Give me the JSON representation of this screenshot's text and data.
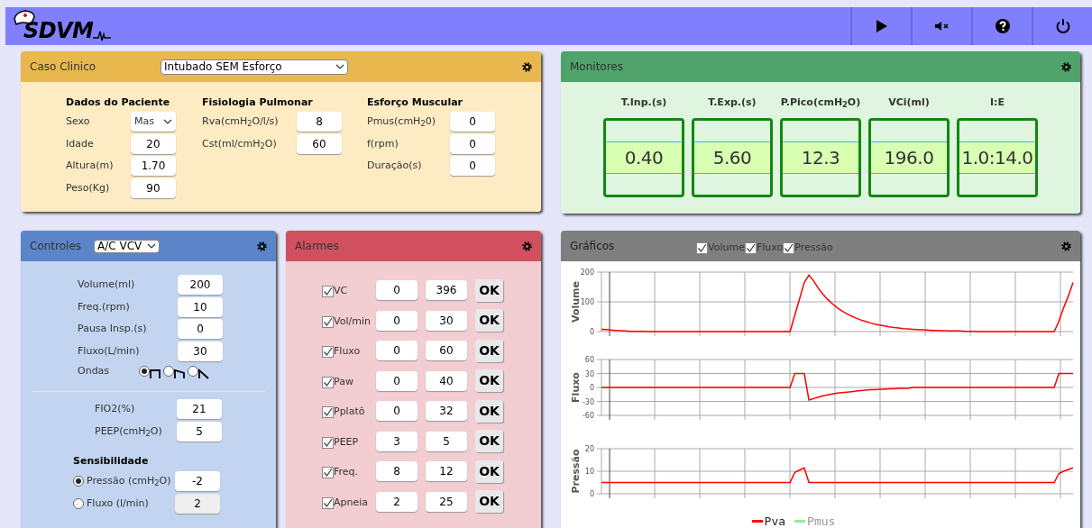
{
  "header": {
    "logo": "SDVM",
    "buttons": [
      {
        "kind": "play"
      },
      {
        "kind": "mute"
      },
      {
        "kind": "help"
      },
      {
        "kind": "power"
      }
    ]
  },
  "caso_clinico": {
    "title": "Caso Clinico",
    "case": "Intubado SEM Esforço",
    "sections": [
      {
        "heading": "Dados do Paciente",
        "fields": [
          {
            "label": "Sexo",
            "value": "Mas",
            "kind": "select"
          },
          {
            "label": "Idade",
            "value": "20",
            "kind": "input"
          },
          {
            "label": "Altura(m)",
            "value": "1.70",
            "kind": "input"
          },
          {
            "label": "Peso(Kg)",
            "value": "90",
            "kind": "input"
          }
        ]
      },
      {
        "heading": "Fisiologia Pulmonar",
        "fields": [
          {
            "label": "Rva(cmH$_{2}$O/l/s)",
            "value": "8",
            "kind": "input"
          },
          {
            "label": "Cst(ml/cmH$_{2}$O)",
            "value": "60",
            "kind": "input"
          }
        ]
      },
      {
        "heading": "Esforço Muscular",
        "fields": [
          {
            "label": "Pmus(cmH$_{2}$0)",
            "value": "0",
            "kind": "input"
          },
          {
            "label": "f(rpm)",
            "value": "0",
            "kind": "input"
          },
          {
            "label": "Duração(s)",
            "value": "0",
            "kind": "input"
          }
        ]
      }
    ]
  },
  "monitores": {
    "title": "Monitores",
    "items": [
      {
        "label": "T.Inp.(s)",
        "value": "0.40"
      },
      {
        "label": "T.Exp.(s)",
        "value": "5.60"
      },
      {
        "label": "P.Pico(cmH$_{2}$O)",
        "value": "12.3"
      },
      {
        "label": "VCi(ml)",
        "value": "196.0"
      },
      {
        "label": "I:E",
        "value": "1.0:14.0"
      }
    ]
  },
  "controles": {
    "title": "Controles",
    "mode": "A/C VCV",
    "fields": [
      {
        "label": "Volume(ml)",
        "value": "200"
      },
      {
        "label": "Freq.(rpm)",
        "value": "10"
      },
      {
        "label": "Pausa Insp.(s)",
        "value": "0"
      },
      {
        "label": "Fluxo(L/min)",
        "value": "30"
      }
    ],
    "waves": {
      "label": "Ondas",
      "options": [
        {
          "kind": "square",
          "selected": true
        },
        {
          "kind": "descending",
          "selected": false
        },
        {
          "kind": "ramp",
          "selected": false
        }
      ]
    },
    "fields2": [
      {
        "label": "FIO2(%)",
        "value": "21"
      },
      {
        "label": "PEEP(cmH$_{2}$O)",
        "value": "5"
      }
    ],
    "sensibilidade": {
      "heading": "Sensibilidade",
      "options": [
        {
          "label": "Pressão (cmH$_{2}$O)",
          "value": "-2",
          "selected": true
        },
        {
          "label": "Fluxo (l/min)",
          "value": "2",
          "selected": false
        }
      ]
    }
  },
  "alarmes": {
    "title": "Alarmes",
    "rows": [
      {
        "label": "VC",
        "checked": true,
        "min": "0",
        "max": "396",
        "button": "OK"
      },
      {
        "label": "Vol/min",
        "checked": true,
        "min": "0",
        "max": "30",
        "button": "OK"
      },
      {
        "label": "Fluxo",
        "checked": true,
        "min": "0",
        "max": "60",
        "button": "OK"
      },
      {
        "label": "Paw",
        "checked": true,
        "min": "0",
        "max": "40",
        "button": "OK"
      },
      {
        "label": "Pplatô",
        "checked": true,
        "min": "0",
        "max": "32",
        "button": "OK"
      },
      {
        "label": "PEEP",
        "checked": true,
        "min": "3",
        "max": "5",
        "button": "OK"
      },
      {
        "label": "Freq.",
        "checked": true,
        "min": "8",
        "max": "12",
        "button": "OK"
      },
      {
        "label": "Apneia",
        "checked": true,
        "min": "2",
        "max": "25",
        "button": "OK"
      }
    ]
  },
  "graficos": {
    "title": "Gráficos",
    "toggles": [
      {
        "label": "Volume",
        "checked": true
      },
      {
        "label": "Fluxo",
        "checked": true
      },
      {
        "label": "Pressão",
        "checked": true
      }
    ],
    "charts": [
      {
        "chart_data": {
          "type": "line",
          "grid": true,
          "ylabel": "Volume",
          "ylim": [
            0,
            200
          ],
          "yticks": [
            0,
            100,
            200
          ],
          "categories": [
            null,
            null,
            null,
            null,
            null,
            null,
            null,
            null,
            null,
            null,
            null,
            null,
            null,
            null,
            null,
            null,
            null,
            null,
            null,
            null,
            null,
            null,
            null,
            null,
            null,
            null,
            null,
            null,
            null,
            null,
            null,
            null,
            null,
            null,
            null,
            null,
            null,
            null,
            null,
            null,
            null,
            null,
            null,
            null,
            null,
            null,
            null,
            null,
            null,
            null,
            null,
            null,
            null,
            null,
            null,
            null,
            null,
            null,
            null,
            null,
            null,
            null,
            null,
            null,
            null,
            null,
            null,
            null,
            null,
            null,
            null,
            null,
            null,
            null,
            null,
            null,
            null,
            null,
            null,
            null,
            null,
            null,
            null,
            null,
            null,
            null,
            null,
            null,
            null,
            null,
            null,
            null,
            null,
            null,
            null,
            null,
            null,
            null,
            null,
            null,
            null
          ],
          "series": [
            {
              "color": "#ff0000",
              "values": [
                8,
                7,
                5,
                4,
                3,
                2,
                1,
                1,
                1,
                1,
                0,
                0,
                0,
                0,
                0,
                0,
                0,
                0,
                0,
                0,
                0,
                0,
                0,
                0,
                0,
                0,
                0,
                0,
                0,
                0,
                0,
                0,
                0,
                0,
                0,
                0,
                0,
                0,
                0,
                0,
                0,
                55,
                110,
                165,
                190,
                170,
                145,
                125,
                108,
                93,
                80,
                69,
                60,
                52,
                45,
                39,
                34,
                29,
                25,
                22,
                19,
                16,
                14,
                12,
                10,
                9,
                8,
                7,
                6,
                5,
                4,
                4,
                3,
                3,
                2,
                2,
                2,
                1,
                1,
                1,
                0,
                0,
                0,
                0,
                0,
                0,
                0,
                0,
                0,
                0,
                0,
                0,
                0,
                0,
                0,
                0,
                0,
                35,
                80,
                120,
                165
              ]
            }
          ]
        }
      },
      {
        "chart_data": {
          "type": "line",
          "grid": true,
          "ylabel": "Fluxo",
          "ylim": [
            -60,
            60
          ],
          "yticks": [
            -60,
            -30,
            0,
            30,
            60
          ],
          "categories": [
            null,
            null,
            null,
            null,
            null,
            null,
            null,
            null,
            null,
            null,
            null,
            null,
            null,
            null,
            null,
            null,
            null,
            null,
            null,
            null,
            null,
            null,
            null,
            null,
            null,
            null,
            null,
            null,
            null,
            null,
            null,
            null,
            null,
            null,
            null,
            null,
            null,
            null,
            null,
            null,
            null,
            null,
            null,
            null,
            null,
            null,
            null,
            null,
            null,
            null,
            null,
            null,
            null,
            null,
            null,
            null,
            null,
            null,
            null,
            null,
            null,
            null,
            null,
            null,
            null,
            null,
            null,
            null,
            null,
            null,
            null,
            null,
            null,
            null,
            null,
            null,
            null,
            null,
            null,
            null,
            null,
            null,
            null,
            null,
            null,
            null,
            null,
            null,
            null,
            null,
            null,
            null,
            null,
            null,
            null,
            null,
            null,
            null,
            null,
            null,
            null
          ],
          "series": [
            {
              "color": "#ff0000",
              "values": [
                0,
                0,
                0,
                0,
                0,
                0,
                0,
                0,
                0,
                0,
                0,
                0,
                0,
                0,
                0,
                0,
                0,
                0,
                0,
                0,
                0,
                0,
                0,
                0,
                0,
                0,
                0,
                0,
                0,
                0,
                0,
                0,
                0,
                0,
                0,
                0,
                0,
                0,
                0,
                0,
                0,
                30,
                30,
                30,
                -27,
                -24,
                -21,
                -18,
                -16,
                -14,
                -12,
                -11,
                -10,
                -9,
                -8,
                -7,
                -6,
                -5,
                -5,
                -4,
                -4,
                -3,
                -3,
                -2,
                -2,
                -2,
                0,
                0,
                0,
                0,
                0,
                0,
                0,
                0,
                0,
                0,
                0,
                0,
                0,
                0,
                0,
                0,
                0,
                0,
                0,
                0,
                0,
                0,
                0,
                0,
                0,
                0,
                0,
                0,
                0,
                0,
                0,
                30,
                30,
                30,
                30
              ]
            }
          ]
        }
      },
      {
        "chart_data": {
          "type": "line",
          "grid": true,
          "ylabel": "Pressão",
          "ylim": [
            0,
            20
          ],
          "yticks": [
            0,
            10,
            20
          ],
          "categories": [
            null,
            null,
            null,
            null,
            null,
            null,
            null,
            null,
            null,
            null,
            null,
            null,
            null,
            null,
            null,
            null,
            null,
            null,
            null,
            null,
            null,
            null,
            null,
            null,
            null,
            null,
            null,
            null,
            null,
            null,
            null,
            null,
            null,
            null,
            null,
            null,
            null,
            null,
            null,
            null,
            null,
            null,
            null,
            null,
            null,
            null,
            null,
            null,
            null,
            null,
            null,
            null,
            null,
            null,
            null,
            null,
            null,
            null,
            null,
            null,
            null,
            null,
            null,
            null,
            null,
            null,
            null,
            null,
            null,
            null,
            null,
            null,
            null,
            null,
            null,
            null,
            null,
            null,
            null,
            null,
            null,
            null,
            null,
            null,
            null,
            null,
            null,
            null,
            null,
            null,
            null,
            null,
            null,
            null,
            null,
            null,
            null,
            null,
            null,
            null,
            null
          ],
          "series": [
            {
              "name": "Pva",
              "color": "#ff0000",
              "values": [
                5,
                5,
                5,
                5,
                5,
                5,
                5,
                5,
                5,
                5,
                5,
                5,
                5,
                5,
                5,
                5,
                5,
                5,
                5,
                5,
                5,
                5,
                5,
                5,
                5,
                5,
                5,
                5,
                5,
                5,
                5,
                5,
                5,
                5,
                5,
                5,
                5,
                5,
                5,
                5,
                5,
                9.5,
                10.5,
                11.5,
                5,
                5,
                5,
                5,
                5,
                5,
                5,
                5,
                5,
                5,
                5,
                5,
                5,
                5,
                5,
                5,
                5,
                5,
                5,
                5,
                5,
                5,
                5,
                5,
                5,
                5,
                5,
                5,
                5,
                5,
                5,
                5,
                5,
                5,
                5,
                5,
                5,
                5,
                5,
                5,
                5,
                5,
                5,
                5,
                5,
                5,
                5,
                5,
                5,
                5,
                5,
                5,
                5,
                9,
                10,
                10.8,
                11.5
              ]
            }
          ]
        }
      }
    ],
    "legend": [
      {
        "name": "Pmus",
        "color": "#90ee90"
      }
    ]
  }
}
